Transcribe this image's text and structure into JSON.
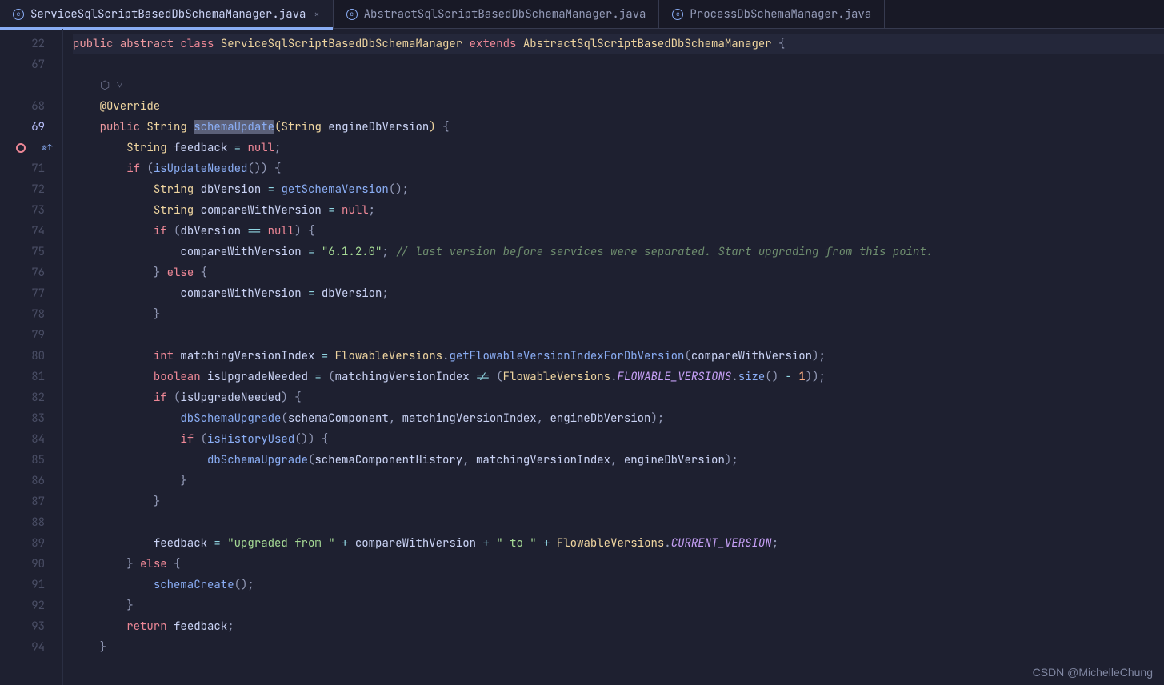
{
  "tabs": [
    {
      "name": "ServiceSqlScriptBasedDbSchemaManager.java",
      "active": true,
      "closable": true
    },
    {
      "name": "AbstractSqlScriptBasedDbSchemaManager.java",
      "active": false,
      "closable": false
    },
    {
      "name": "ProcessDbSchemaManager.java",
      "active": false,
      "closable": false
    }
  ],
  "gutter": {
    "lines": [
      "22",
      "67",
      "",
      "68",
      "69",
      "",
      "71",
      "72",
      "73",
      "74",
      "75",
      "76",
      "77",
      "78",
      "79",
      "80",
      "81",
      "82",
      "83",
      "84",
      "85",
      "86",
      "87",
      "88",
      "89",
      "90",
      "91",
      "92",
      "93",
      "94"
    ]
  },
  "code": {
    "contextLine": {
      "tokens": [
        {
          "t": "public ",
          "c": "keyword-mod"
        },
        {
          "t": "abstract ",
          "c": "keyword-mod"
        },
        {
          "t": "class ",
          "c": "keyword"
        },
        {
          "t": "ServiceSqlScriptBasedDbSchemaManager ",
          "c": "type"
        },
        {
          "t": "extends ",
          "c": "keyword"
        },
        {
          "t": "AbstractSqlScriptBasedDbSchemaManager ",
          "c": "type"
        },
        {
          "t": "{",
          "c": "punct"
        }
      ]
    },
    "line68": {
      "tokens": [
        {
          "t": "@Override",
          "c": "annotation"
        }
      ]
    },
    "line69": {
      "tokens": [
        {
          "t": "public ",
          "c": "keyword-mod"
        },
        {
          "t": "String ",
          "c": "type"
        },
        {
          "t": "schemaUpdate",
          "c": "method highlight-sel"
        },
        {
          "t": "(",
          "c": "brace-hl"
        },
        {
          "t": "String ",
          "c": "type"
        },
        {
          "t": "engineDbVersion",
          "c": "param"
        },
        {
          "t": ") ",
          "c": "brace-hl"
        },
        {
          "t": "{",
          "c": "punct"
        }
      ]
    },
    "line70": {
      "tokens": [
        {
          "t": "String ",
          "c": "type"
        },
        {
          "t": "feedback ",
          "c": "var"
        },
        {
          "t": "= ",
          "c": "op"
        },
        {
          "t": "null",
          "c": "null-kw"
        },
        {
          "t": ";",
          "c": "punct"
        }
      ]
    },
    "line71": {
      "tokens": [
        {
          "t": "if ",
          "c": "keyword"
        },
        {
          "t": "(",
          "c": "punct"
        },
        {
          "t": "isUpdateNeeded",
          "c": "method-call"
        },
        {
          "t": "()",
          "c": "punct"
        },
        {
          "t": ") ",
          "c": "punct"
        },
        {
          "t": "{",
          "c": "punct"
        }
      ]
    },
    "line72": {
      "tokens": [
        {
          "t": "String ",
          "c": "type"
        },
        {
          "t": "dbVersion ",
          "c": "var"
        },
        {
          "t": "= ",
          "c": "op"
        },
        {
          "t": "getSchemaVersion",
          "c": "method-call"
        },
        {
          "t": "();",
          "c": "punct"
        }
      ]
    },
    "line73": {
      "tokens": [
        {
          "t": "String ",
          "c": "type"
        },
        {
          "t": "compareWithVersion ",
          "c": "var"
        },
        {
          "t": "= ",
          "c": "op"
        },
        {
          "t": "null",
          "c": "null-kw"
        },
        {
          "t": ";",
          "c": "punct"
        }
      ]
    },
    "line74": {
      "tokens": [
        {
          "t": "if ",
          "c": "keyword"
        },
        {
          "t": "(",
          "c": "punct"
        },
        {
          "t": "dbVersion ",
          "c": "var"
        },
        {
          "t": "== ",
          "c": "op"
        },
        {
          "t": "null",
          "c": "null-kw"
        },
        {
          "t": ") ",
          "c": "punct"
        },
        {
          "t": "{",
          "c": "punct"
        }
      ]
    },
    "line75": {
      "tokens": [
        {
          "t": "compareWithVersion ",
          "c": "var"
        },
        {
          "t": "= ",
          "c": "op"
        },
        {
          "t": "\"6.1.2.0\"",
          "c": "string"
        },
        {
          "t": "; ",
          "c": "punct"
        },
        {
          "t": "// last version before services were separated. Start upgrading from this point.",
          "c": "comment"
        }
      ]
    },
    "line76": {
      "tokens": [
        {
          "t": "} ",
          "c": "punct"
        },
        {
          "t": "else ",
          "c": "keyword"
        },
        {
          "t": "{",
          "c": "punct"
        }
      ]
    },
    "line77": {
      "tokens": [
        {
          "t": "compareWithVersion ",
          "c": "var"
        },
        {
          "t": "= ",
          "c": "op"
        },
        {
          "t": "dbVersion",
          "c": "var"
        },
        {
          "t": ";",
          "c": "punct"
        }
      ]
    },
    "line78": {
      "tokens": [
        {
          "t": "}",
          "c": "punct"
        }
      ]
    },
    "line80": {
      "tokens": [
        {
          "t": "int ",
          "c": "keyword"
        },
        {
          "t": "matchingVersionIndex ",
          "c": "var"
        },
        {
          "t": "= ",
          "c": "op"
        },
        {
          "t": "FlowableVersions",
          "c": "type"
        },
        {
          "t": ".",
          "c": "punct"
        },
        {
          "t": "getFlowableVersionIndexForDbVersion",
          "c": "method-call"
        },
        {
          "t": "(",
          "c": "punct"
        },
        {
          "t": "compareWithVersion",
          "c": "var"
        },
        {
          "t": ");",
          "c": "punct"
        }
      ]
    },
    "line81": {
      "tokens": [
        {
          "t": "boolean ",
          "c": "keyword"
        },
        {
          "t": "isUpgradeNeeded ",
          "c": "var"
        },
        {
          "t": "= ",
          "c": "op"
        },
        {
          "t": "(",
          "c": "punct"
        },
        {
          "t": "matchingVersionIndex ",
          "c": "var"
        },
        {
          "t": "!= ",
          "c": "op"
        },
        {
          "t": "(",
          "c": "punct"
        },
        {
          "t": "FlowableVersions",
          "c": "type"
        },
        {
          "t": ".",
          "c": "punct"
        },
        {
          "t": "FLOWABLE_VERSIONS",
          "c": "const-static"
        },
        {
          "t": ".",
          "c": "punct"
        },
        {
          "t": "size",
          "c": "method-call"
        },
        {
          "t": "() ",
          "c": "punct"
        },
        {
          "t": "- ",
          "c": "op"
        },
        {
          "t": "1",
          "c": "number"
        },
        {
          "t": "));",
          "c": "punct"
        }
      ]
    },
    "line82": {
      "tokens": [
        {
          "t": "if ",
          "c": "keyword"
        },
        {
          "t": "(",
          "c": "punct"
        },
        {
          "t": "isUpgradeNeeded",
          "c": "var"
        },
        {
          "t": ") ",
          "c": "punct"
        },
        {
          "t": "{",
          "c": "punct"
        }
      ]
    },
    "line83": {
      "tokens": [
        {
          "t": "dbSchemaUpgrade",
          "c": "method-call"
        },
        {
          "t": "(",
          "c": "punct"
        },
        {
          "t": "schemaComponent",
          "c": "var"
        },
        {
          "t": ", ",
          "c": "punct"
        },
        {
          "t": "matchingVersionIndex",
          "c": "var"
        },
        {
          "t": ", ",
          "c": "punct"
        },
        {
          "t": "engineDbVersion",
          "c": "var"
        },
        {
          "t": ");",
          "c": "punct"
        }
      ]
    },
    "line84": {
      "tokens": [
        {
          "t": "if ",
          "c": "keyword"
        },
        {
          "t": "(",
          "c": "punct"
        },
        {
          "t": "isHistoryUsed",
          "c": "method-call"
        },
        {
          "t": "()) ",
          "c": "punct"
        },
        {
          "t": "{",
          "c": "punct"
        }
      ]
    },
    "line85": {
      "tokens": [
        {
          "t": "dbSchemaUpgrade",
          "c": "method-call"
        },
        {
          "t": "(",
          "c": "punct"
        },
        {
          "t": "schemaComponentHistory",
          "c": "var"
        },
        {
          "t": ", ",
          "c": "punct"
        },
        {
          "t": "matchingVersionIndex",
          "c": "var"
        },
        {
          "t": ", ",
          "c": "punct"
        },
        {
          "t": "engineDbVersion",
          "c": "var"
        },
        {
          "t": ");",
          "c": "punct"
        }
      ]
    },
    "line86": {
      "tokens": [
        {
          "t": "}",
          "c": "punct"
        }
      ]
    },
    "line87": {
      "tokens": [
        {
          "t": "}",
          "c": "punct"
        }
      ]
    },
    "line89": {
      "tokens": [
        {
          "t": "feedback ",
          "c": "var"
        },
        {
          "t": "= ",
          "c": "op"
        },
        {
          "t": "\"upgraded from \"",
          "c": "string"
        },
        {
          "t": " + ",
          "c": "op"
        },
        {
          "t": "compareWithVersion ",
          "c": "var"
        },
        {
          "t": "+ ",
          "c": "op"
        },
        {
          "t": "\" to \"",
          "c": "string"
        },
        {
          "t": " + ",
          "c": "op"
        },
        {
          "t": "FlowableVersions",
          "c": "type"
        },
        {
          "t": ".",
          "c": "punct"
        },
        {
          "t": "CURRENT_VERSION",
          "c": "const-static"
        },
        {
          "t": ";",
          "c": "punct"
        }
      ]
    },
    "line90": {
      "tokens": [
        {
          "t": "} ",
          "c": "punct"
        },
        {
          "t": "else ",
          "c": "keyword"
        },
        {
          "t": "{",
          "c": "punct"
        }
      ]
    },
    "line91": {
      "tokens": [
        {
          "t": "schemaCreate",
          "c": "method-call"
        },
        {
          "t": "();",
          "c": "punct"
        }
      ]
    },
    "line92": {
      "tokens": [
        {
          "t": "}",
          "c": "punct"
        }
      ]
    },
    "line93": {
      "tokens": [
        {
          "t": "return ",
          "c": "keyword"
        },
        {
          "t": "feedback",
          "c": "var"
        },
        {
          "t": ";",
          "c": "punct"
        }
      ]
    },
    "line94": {
      "tokens": [
        {
          "t": "}",
          "c": "punct"
        }
      ]
    }
  },
  "indents": {
    "l68": 4,
    "l69": 4,
    "l70": 8,
    "l71": 8,
    "l72": 12,
    "l73": 12,
    "l74": 12,
    "l75": 16,
    "l76": 12,
    "l77": 16,
    "l78": 12,
    "l80": 12,
    "l81": 12,
    "l82": 12,
    "l83": 16,
    "l84": 16,
    "l85": 20,
    "l86": 16,
    "l87": 12,
    "l89": 12,
    "l90": 8,
    "l91": 12,
    "l92": 8,
    "l93": 8,
    "l94": 4
  },
  "watermark": "CSDN @MichelleChung"
}
